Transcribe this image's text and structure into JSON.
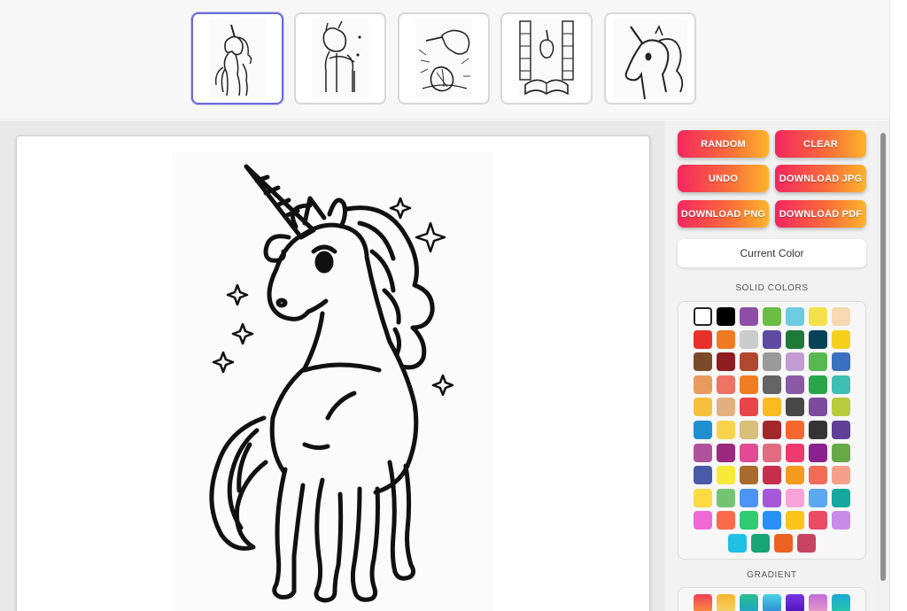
{
  "thumbnails": [
    {
      "name": "standing-unicorn",
      "active": true
    },
    {
      "name": "baby-pony",
      "active": false
    },
    {
      "name": "unicorn-with-shell",
      "active": false
    },
    {
      "name": "unicorn-reading-book",
      "active": false
    },
    {
      "name": "unicorn-head-portrait",
      "active": false
    }
  ],
  "buttons": {
    "random": "RANDOM",
    "clear": "CLEAR",
    "undo": "UNDO",
    "download_jpg": "DOWNLOAD JPG",
    "download_png": "DOWNLOAD PNG",
    "download_pdf": "DOWNLOAD PDF"
  },
  "current_color_label": "Current Color",
  "solid_colors_title": "SOLID COLORS",
  "gradient_title": "GRADIENT",
  "selected_color": "#ffffff",
  "solid_colors": [
    "#ffffff",
    "#000000",
    "#8e4fa8",
    "#6cbd45",
    "#6ccbe0",
    "#f4e04a",
    "#f6d9b0",
    "#e8302b",
    "#f07a22",
    "#cccccc",
    "#5e4aa0",
    "#1f7a3a",
    "#064359",
    "#f5cf1b",
    "#7a4a2a",
    "#8f1c1e",
    "#b04830",
    "#9a9a9a",
    "#c29bd2",
    "#58b850",
    "#3a70c0",
    "#e89b5c",
    "#ee7362",
    "#f17d23",
    "#646464",
    "#8b5aa6",
    "#27a548",
    "#3fbfb4",
    "#f6c03c",
    "#e2b07f",
    "#e9464b",
    "#fbbb20",
    "#474747",
    "#7c4b9e",
    "#b8cc3b",
    "#1f8fd0",
    "#f7d44c",
    "#d8c07a",
    "#a3282c",
    "#f6672b",
    "#343434",
    "#5f3f98",
    "#b0539c",
    "#9c2a7c",
    "#e24a93",
    "#e16c82",
    "#f0396e",
    "#8b208e",
    "#65a844",
    "#4a5aa8",
    "#f7ea39",
    "#a86b2b",
    "#c62f4c",
    "#f49a1f",
    "#f16c56",
    "#f6a089",
    "#fddb43",
    "#74c474",
    "#4c94f4",
    "#a658d8",
    "#f8a2d8",
    "#5aa8f0",
    "#14a89e",
    "#f06ad6",
    "#fb6a4a",
    "#2fcc72",
    "#2a90f8",
    "#fcc419",
    "#ea4b65",
    "#c98be8",
    "#1ec0e6",
    "#17a575",
    "#ec6122",
    "#c64460"
  ],
  "gradients": [
    [
      "#f2405a",
      "#f78e3c"
    ],
    [
      "#f7b42c",
      "#f5d36a"
    ],
    [
      "#2ac08a",
      "#20a2c8"
    ],
    [
      "#4ad2e2",
      "#2c8ad8"
    ],
    [
      "#7a34e6",
      "#4a18b8"
    ],
    [
      "#c06cd8",
      "#e89bc8"
    ],
    [
      "#1ea8d8",
      "#24c8a8"
    ]
  ]
}
